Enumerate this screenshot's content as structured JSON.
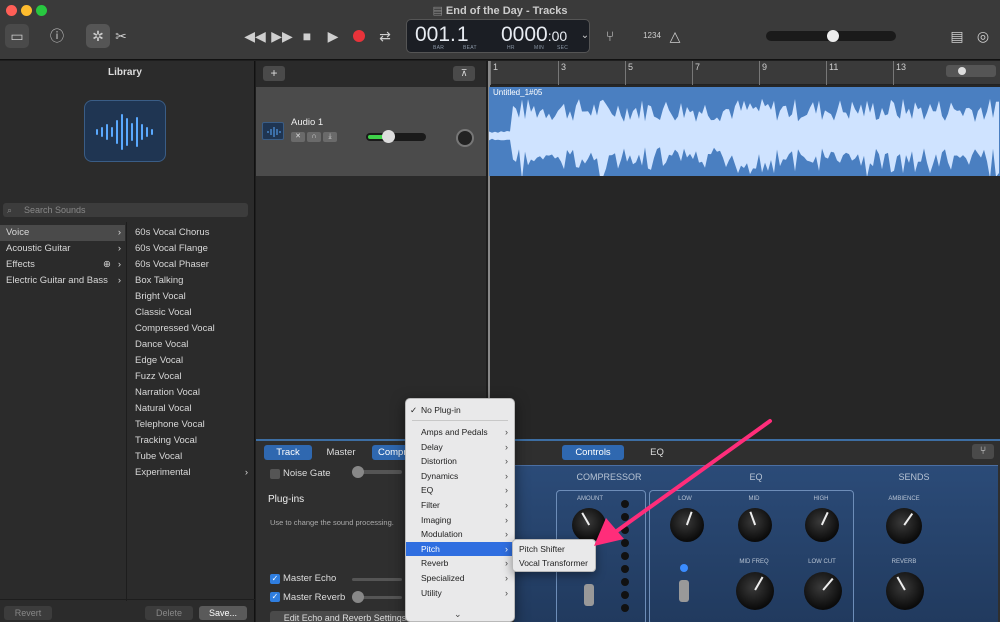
{
  "window": {
    "title": "End of the Day - Tracks"
  },
  "transport": {
    "bar": "1",
    "beat": "1",
    "bar_dim": "00",
    "beat_sep": ".",
    "hr_dim": "00",
    "min": "00",
    "sec": ":00",
    "bar_label": "BAR",
    "beat_label": "BEAT",
    "hr_label": "HR",
    "min_label": "MIN",
    "sec_label": "SEC",
    "count_in": "1234"
  },
  "library": {
    "title": "Library",
    "search_placeholder": "Search Sounds",
    "categories": [
      "Voice",
      "Acoustic Guitar",
      "Effects",
      "Electric Guitar and Bass"
    ],
    "sounds": [
      "60s Vocal Chorus",
      "60s Vocal Flange",
      "60s Vocal Phaser",
      "Box Talking",
      "Bright Vocal",
      "Classic Vocal",
      "Compressed Vocal",
      "Dance Vocal",
      "Edge Vocal",
      "Fuzz Vocal",
      "Narration Vocal",
      "Natural Vocal",
      "Telephone Vocal",
      "Tracking Vocal",
      "Tube Vocal",
      "Experimental"
    ],
    "revert": "Revert",
    "delete": "Delete",
    "save": "Save..."
  },
  "tracks": {
    "track_name": "Audio 1",
    "region_name": "Untitled_1#05",
    "ruler": [
      "1",
      "3",
      "5",
      "7",
      "9",
      "11",
      "13"
    ],
    "volume": 0.35
  },
  "editor": {
    "tabs": [
      "Track",
      "Master",
      "Compressor"
    ],
    "right_tabs": [
      "Controls",
      "EQ"
    ],
    "noise_gate": "Noise Gate",
    "plugins_title": "Plug-ins",
    "plugins_desc": "Use to change the sound processing.",
    "master_echo": "Master Echo",
    "master_reverb": "Master Reverb",
    "edit_button": "Edit Echo and Reverb Settings",
    "panel": {
      "compressor": "COMPRESSOR",
      "eq": "EQ",
      "sends": "SENDS",
      "amount": "AMOUNT",
      "low": "LOW",
      "mid": "MID",
      "high": "HIGH",
      "mid_freq": "MID FREQ",
      "low_cut": "LOW CUT",
      "ambience": "AMBIENCE",
      "reverb": "REVERB"
    }
  },
  "menu": {
    "items": [
      "No Plug-in",
      "Amps and Pedals",
      "Delay",
      "Distortion",
      "Dynamics",
      "EQ",
      "Filter",
      "Imaging",
      "Modulation",
      "Pitch",
      "Reverb",
      "Specialized",
      "Utility"
    ],
    "checked": "No Plug-in",
    "highlighted": "Pitch",
    "submenu": [
      "Pitch Shifter",
      "Vocal Transformer"
    ]
  },
  "colors": {
    "accent": "#2f68b0",
    "arrow": "#ff2d7a",
    "region": "#4a7fc1",
    "waveform": "#cfe3ff"
  }
}
